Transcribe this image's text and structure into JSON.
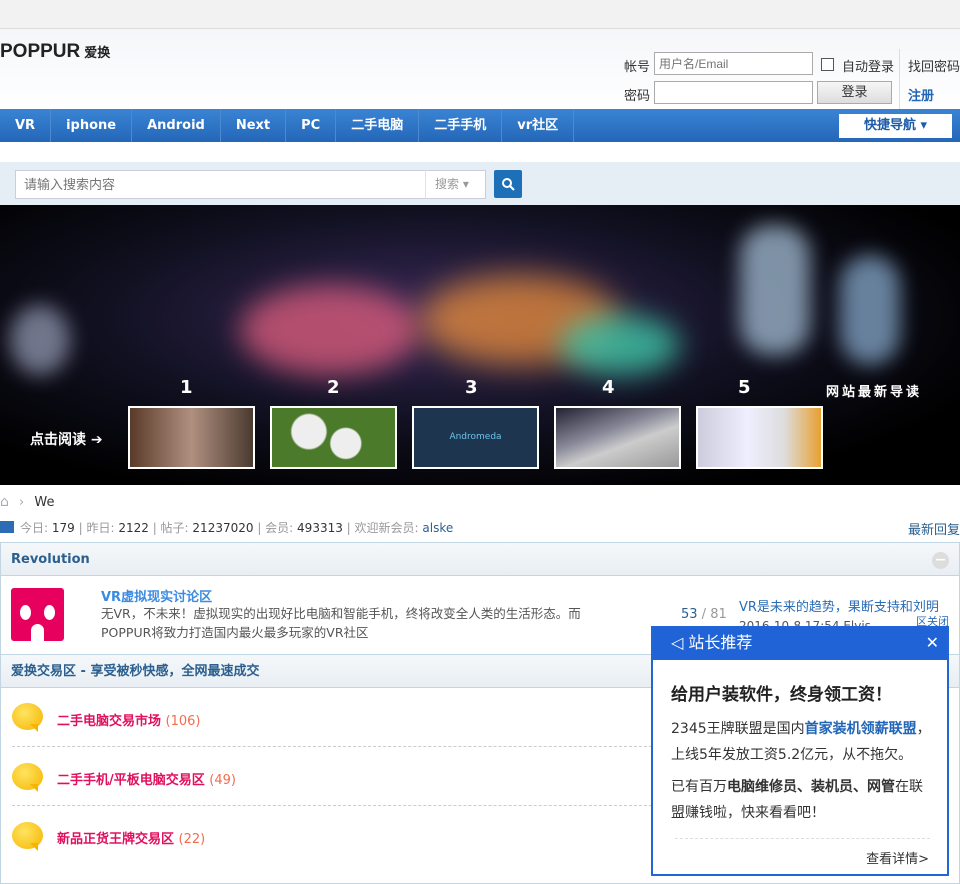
{
  "header": {
    "logo": "POPPUR",
    "logo_cn": "爱换",
    "account_label": "帐号",
    "account_placeholder": "用户名/Email",
    "password_label": "密码",
    "auto_login": "自动登录",
    "find_password": "找回密码",
    "login": "登录",
    "register": "注册"
  },
  "nav": {
    "items": [
      "VR",
      "iphone",
      "Android",
      "Next",
      "PC",
      "二手电脑",
      "二手手机",
      "vr社区"
    ],
    "quick_nav": "快捷导航 ▾"
  },
  "search": {
    "placeholder": "请输入搜索内容",
    "type": "搜索 ▾"
  },
  "banner": {
    "read_label": "点击阅读 ➔",
    "latest_label": "网站最新导读",
    "numbers": [
      "1",
      "2",
      "3",
      "4",
      "5"
    ],
    "thumb3_text": "Andromeda"
  },
  "breadcrumb": {
    "current": "We"
  },
  "stats": {
    "today_label": "今日:",
    "today": "179",
    "yesterday_label": "昨日:",
    "yesterday": "2122",
    "posts_label": "帖子:",
    "posts": "21237020",
    "members_label": "会员:",
    "members": "493313",
    "welcome_label": "欢迎新会员:",
    "new_member": "alske",
    "latest_reply": "最新回复"
  },
  "section1": {
    "title": "Revolution",
    "forum": {
      "name": "VR虚拟现实讨论区",
      "desc": "无VR，不未来！虚拟现实的出现好比电脑和智能手机，终将改变全人类的生活形态。而POPPUR将致力打造国内最火最多玩家的VR社区",
      "threads": "53",
      "posts": "81",
      "last_title": "VR是未来的趋势，果断支持和刘明",
      "last_time": "2016-10-8 17:54 Elvis"
    },
    "close": "区关闭"
  },
  "section2": {
    "title": "爱换交易区 - 享受被秒快感，全网最速成交",
    "forums": [
      {
        "name": "二手电脑交易市场",
        "count": "(106)"
      },
      {
        "name": "二手手机/平板电脑交易区",
        "count": "(49)"
      },
      {
        "name": "新品正货王牌交易区",
        "count": "(22)"
      }
    ]
  },
  "popup": {
    "title": "站长推荐",
    "headline": "给用户装软件，终身领工资！",
    "p1a": "2345王牌联盟是国内",
    "p1b": "首家装机领薪联盟",
    "p1c": "，上线5年发放工资5.2亿元，从不拖欠。",
    "p2a": "已有百万",
    "p2b": "电脑维修员、装机员、网管",
    "p2c": "在联盟赚钱啦，快来看看吧！",
    "more": "查看详情>"
  }
}
